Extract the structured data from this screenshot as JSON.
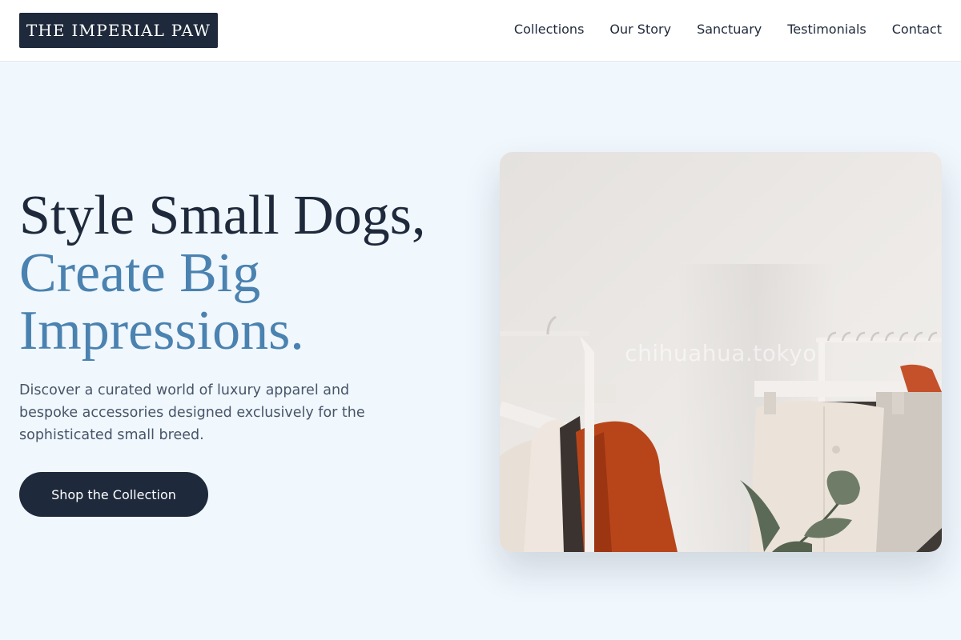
{
  "brand": {
    "name": "THE IMPERIAL PAW"
  },
  "nav": {
    "items": [
      {
        "label": "Collections"
      },
      {
        "label": "Our Story"
      },
      {
        "label": "Sanctuary"
      },
      {
        "label": "Testimonials"
      },
      {
        "label": "Contact"
      }
    ]
  },
  "hero": {
    "headline_line1": "Style Small Dogs,",
    "headline_line2": "Create Big Impressions.",
    "description": "Discover a curated world of luxury apparel and bespoke accessories designed exclusively for the sophisticated small breed.",
    "cta_label": "Shop the Collection",
    "image": {
      "watermark": "chihuahua.tokyo",
      "subject": "clothing racks with hangers and a potted plant"
    }
  },
  "colors": {
    "background": "#f0f7fd",
    "primary": "#1e293b",
    "accent": "#4a82b0",
    "body_text": "#475569"
  }
}
